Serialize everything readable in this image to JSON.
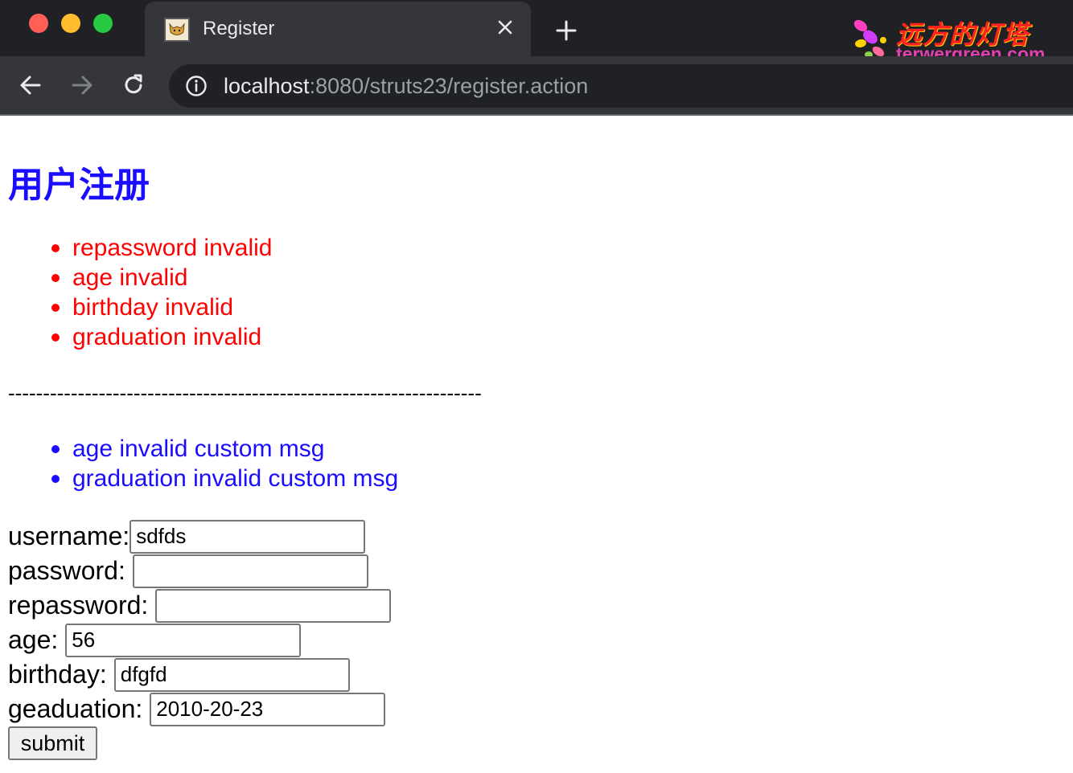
{
  "browser": {
    "tab_title": "Register",
    "url_host": "localhost",
    "url_rest": ":8080/struts23/register.action",
    "logo_cn": "远方的灯塔",
    "logo_en": "terwergreen.com"
  },
  "page": {
    "heading": "用户注册",
    "field_errors": [
      "repassword invalid",
      "age invalid",
      "birthday invalid",
      "graduation invalid"
    ],
    "separator": "--------------------------------------------------------------------",
    "custom_errors": [
      "age invalid custom msg",
      "graduation invalid custom msg"
    ],
    "form": {
      "username_label": "username:",
      "username_value": "sdfds",
      "password_label": "password:",
      "password_value": "",
      "repassword_label": "repassword:",
      "repassword_value": "",
      "age_label": "age:",
      "age_value": "56",
      "birthday_label": "birthday:",
      "birthday_value": "dfgfd",
      "graduation_label": "geaduation:",
      "graduation_value": "2010-20-23",
      "submit_label": "submit"
    }
  },
  "colors": {
    "heading": "#1a0dff",
    "error": "#ff0000",
    "custom_error": "#1a0dff"
  }
}
